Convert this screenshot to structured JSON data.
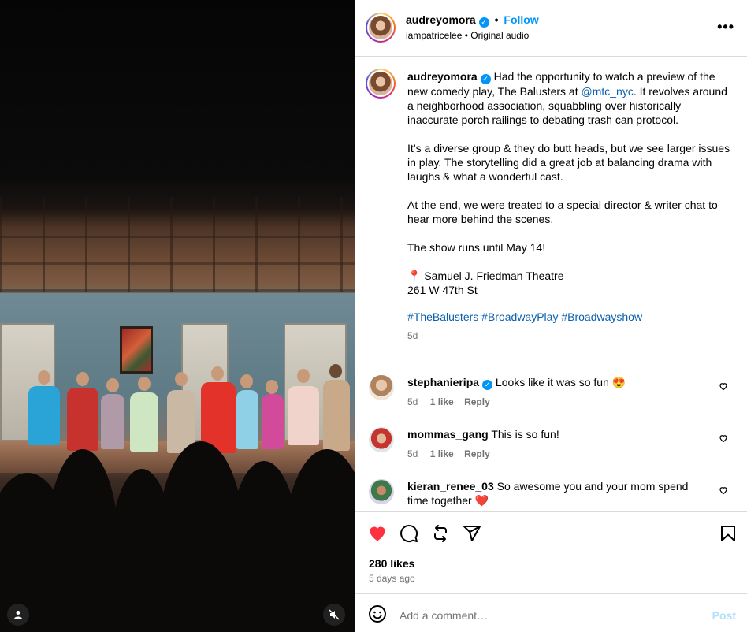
{
  "header": {
    "username": "audreyomora",
    "follow_label": "Follow",
    "audio_user": "iampatricelee",
    "audio_sep": "•",
    "audio_label": "Original audio",
    "more_label": "•••"
  },
  "caption": {
    "username": "audreyomora",
    "p1_a": "Had the opportunity to watch a preview of the new comedy play, The Balusters at ",
    "p1_mention": "@mtc_nyc",
    "p1_b": ". It revolves around a neighborhood association, squabbling over historically inaccurate porch railings to debating trash can protocol.",
    "p2": "It’s a diverse group & they do butt heads, but we see larger issues in play. The storytelling did a great job at balancing drama with laughs & what a wonderful cast.",
    "p3": "At the end, we were treated to a special director & writer chat to hear more behind the scenes.",
    "p4": "The show runs until May 14!",
    "location_pin": "📍",
    "location_line1": "Samuel J. Friedman Theatre",
    "location_line2": "261 W 47th St",
    "hashtags": [
      "#TheBalusters",
      "#BroadwayPlay",
      "#Broadwayshow"
    ],
    "time": "5d"
  },
  "comments": [
    {
      "username": "stephanieripa",
      "verified": true,
      "text": "Looks like it was so fun 😍",
      "time": "5d",
      "likes": "1 like",
      "reply": "Reply"
    },
    {
      "username": "mommas_gang",
      "verified": false,
      "text": "This is so fun!",
      "time": "5d",
      "likes": "1 like",
      "reply": "Reply"
    },
    {
      "username": "kieran_renee_03",
      "verified": false,
      "text": "So awesome you and your mom spend time together ❤️"
    }
  ],
  "actions": {
    "likes": "280 likes",
    "ago": "5 days ago",
    "like_color": "#ff3040"
  },
  "comment_box": {
    "placeholder": "Add a comment…",
    "post_label": "Post"
  },
  "colors": {
    "link": "#0095f6",
    "muted": "#737373",
    "border": "#dbdbdb"
  }
}
